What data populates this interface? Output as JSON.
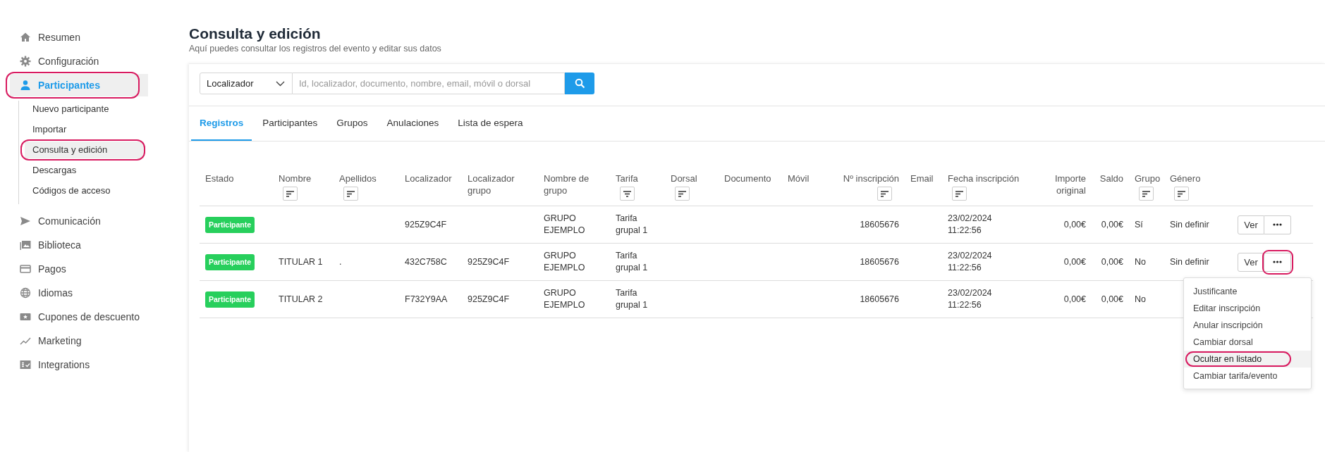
{
  "sidebar": {
    "items": [
      {
        "label": "Resumen",
        "kind": "home",
        "selected": false,
        "annotated": false
      },
      {
        "label": "Configuración",
        "kind": "gear",
        "selected": false,
        "annotated": false
      },
      {
        "label": "Participantes",
        "kind": "person",
        "selected": true,
        "annotated": true,
        "children": [
          {
            "label": "Nuevo participante",
            "selected": false,
            "annotated": false
          },
          {
            "label": "Importar",
            "selected": false,
            "annotated": false
          },
          {
            "label": "Consulta y edición",
            "selected": true,
            "annotated": true
          },
          {
            "label": "Descargas",
            "selected": false,
            "annotated": false
          },
          {
            "label": "Códigos de acceso",
            "selected": false,
            "annotated": false
          }
        ]
      },
      {
        "label": "Comunicación",
        "kind": "send",
        "selected": false,
        "annotated": false
      },
      {
        "label": "Biblioteca",
        "kind": "gallery",
        "selected": false,
        "annotated": false
      },
      {
        "label": "Pagos",
        "kind": "card",
        "selected": false,
        "annotated": false
      },
      {
        "label": "Idiomas",
        "kind": "globe",
        "selected": false,
        "annotated": false
      },
      {
        "label": "Cupones de descuento",
        "kind": "ticket",
        "selected": false,
        "annotated": false
      },
      {
        "label": "Marketing",
        "kind": "trend",
        "selected": false,
        "annotated": false
      },
      {
        "label": "Integrations",
        "kind": "checklist",
        "selected": false,
        "annotated": false
      }
    ]
  },
  "page": {
    "title": "Consulta y edición",
    "subtitle": "Aquí puedes consultar los registros del evento y editar sus datos"
  },
  "search": {
    "field": "Localizador",
    "placeholder": "Id, localizador, documento, nombre, email, móvil o dorsal"
  },
  "tabs": [
    {
      "label": "Registros",
      "selected": true
    },
    {
      "label": "Participantes",
      "selected": false
    },
    {
      "label": "Grupos",
      "selected": false
    },
    {
      "label": "Anulaciones",
      "selected": false
    },
    {
      "label": "Lista de espera",
      "selected": false
    }
  ],
  "table": {
    "columns": [
      {
        "label": "Estado",
        "kind": "badge"
      },
      {
        "label": "Nombre",
        "kind": "text",
        "sort_button": {
          "kind": "sort"
        }
      },
      {
        "label": "Apellidos",
        "kind": "text",
        "sort_button": {
          "kind": "sort"
        }
      },
      {
        "label": "Localizador",
        "kind": "text"
      },
      {
        "label": "Localizador grupo",
        "kind": "text"
      },
      {
        "label": "Nombre de grupo",
        "kind": "text"
      },
      {
        "label": "Tarifa",
        "kind": "text",
        "sort_button": {
          "kind": "filter"
        }
      },
      {
        "label": "Dorsal",
        "kind": "text",
        "sort_button": {
          "kind": "sort"
        }
      },
      {
        "label": "Documento",
        "kind": "text"
      },
      {
        "label": "Móvil",
        "kind": "text"
      },
      {
        "label": "Nº inscripción",
        "kind": "numeric",
        "sort_button": {
          "kind": "sort"
        }
      },
      {
        "label": "Email",
        "kind": "text"
      },
      {
        "label": "Fecha inscripción",
        "kind": "text",
        "sort_button": {
          "kind": "sort"
        }
      },
      {
        "label": "Importe original",
        "kind": "numeric"
      },
      {
        "label": "Saldo",
        "kind": "numeric"
      },
      {
        "label": "Grupo",
        "kind": "text",
        "sort_button": {
          "kind": "sort"
        }
      },
      {
        "label": "Género",
        "kind": "text",
        "sort_button": {
          "kind": "sort"
        }
      }
    ],
    "rows": [
      {
        "cells": [
          "Participante",
          null,
          null,
          "925Z9C4F",
          null,
          "GRUPO EJEMPLO",
          "Tarifa grupal 1",
          null,
          null,
          null,
          "18605676",
          null,
          "23/02/2024 11:22:56",
          "0,00€",
          "0,00€",
          "Sí",
          "Sin definir"
        ],
        "actions": {
          "view": "Ver"
        }
      },
      {
        "cells": [
          "Participante",
          "TITULAR 1",
          ".",
          "432C758C",
          "925Z9C4F",
          "GRUPO EJEMPLO",
          "Tarifa grupal 1",
          null,
          null,
          null,
          "18605676",
          null,
          "23/02/2024 11:22:56",
          "0,00€",
          "0,00€",
          "No",
          "Sin definir"
        ],
        "actions": {
          "view": "Ver",
          "annotated": true
        },
        "menu": [
          {
            "label": "Justificante",
            "selected": false,
            "annotated": false
          },
          {
            "label": "Editar inscripción",
            "selected": false,
            "annotated": false
          },
          {
            "label": "Anular inscripción",
            "selected": false,
            "annotated": false
          },
          {
            "label": "Cambiar dorsal",
            "selected": false,
            "annotated": false
          },
          {
            "label": "Ocultar en listado",
            "selected": true,
            "annotated": true
          },
          {
            "label": "Cambiar tarifa/evento",
            "selected": false,
            "annotated": false
          }
        ]
      },
      {
        "cells": [
          "Participante",
          "TITULAR 2",
          null,
          "F732Y9AA",
          "925Z9C4F",
          "GRUPO EJEMPLO",
          "Tarifa grupal 1",
          null,
          null,
          null,
          "18605676",
          null,
          "23/02/2024 11:22:56",
          "0,00€",
          "0,00€",
          "No"
        ]
      }
    ]
  }
}
